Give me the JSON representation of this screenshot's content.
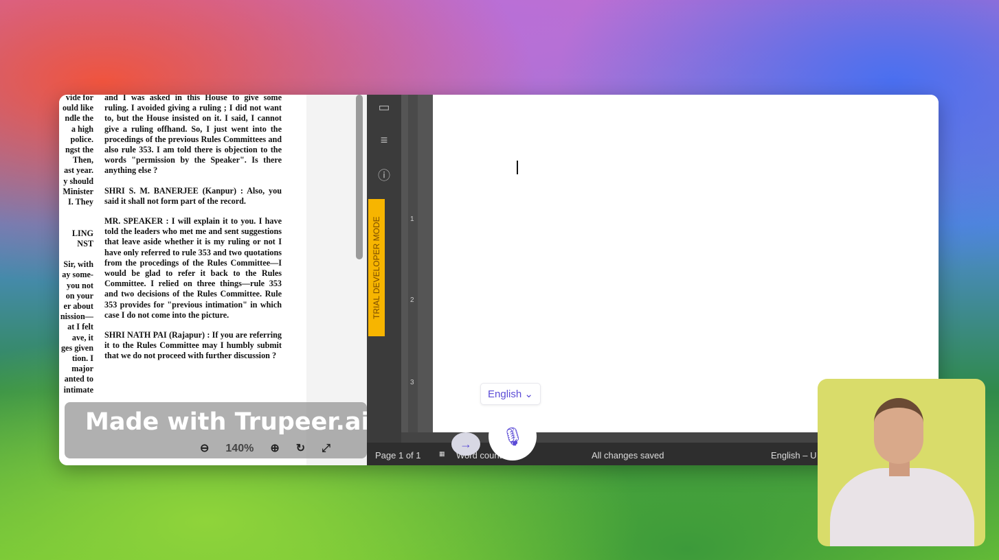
{
  "pdf": {
    "left_fragments": [
      "vide for",
      "ould like",
      "ndle the",
      "a high",
      "police.",
      "ngst the",
      "Then,",
      "ast year.",
      "y should",
      "Minister",
      "I. They",
      "",
      "",
      "LING",
      "NST",
      "",
      "Sir, with",
      "ay some-",
      "you not",
      "on your",
      "er about",
      "nission—",
      "at I felt",
      "ave, it",
      "ges given",
      "tion. I",
      "major",
      "anted to",
      "intimate"
    ],
    "paragraphs": [
      "and I was asked in this House to give some ruling. I avoided giving a ruling ; I did not want to, but the House insisted on it. I said, I cannot give a ruling offhand. So, I just went into the procedings of the previous Rules Committees and also rule 353. I am told there is objection to the words \"permission by the Speaker\". Is there anything else ?",
      "SHRI S. M. BANERJEE (Kanpur) : Also, you said it shall not form part of the record.",
      "MR. SPEAKER : I will explain it to you. I have told the leaders who met me and sent suggestions that leave aside whether it is my ruling or not I have only referred to rule 353 and two quotations from the procedings of the Rules Committee—I would be glad to refer it back to the Rules Committee. I relied on three things—rule 353 and two decisions of the Rules Committee. Rule 353 provides for \"previous intimation\" in which case I do not come into the picture.",
      "SHRI NATH PAI (Rajapur) : If you are referring it to the Rules Committee may I humbly submit that we do not proceed with further discussion ?"
    ],
    "zoom": "140%"
  },
  "watermark": "Made with Trupeer.ai",
  "sidebar": {
    "trial_label": "TRIAL DEVELOPER MODE"
  },
  "ruler": {
    "marks": [
      "1",
      "2",
      "3"
    ]
  },
  "editor": {
    "language": "English"
  },
  "status": {
    "page": "Page 1 of 1",
    "word_count": "Word count",
    "saved": "All changes saved",
    "language": "English – U"
  },
  "colors": {
    "accent": "#5b4bd6",
    "trial": "#f7b500",
    "avatar_bg": "#d9dc6a"
  }
}
